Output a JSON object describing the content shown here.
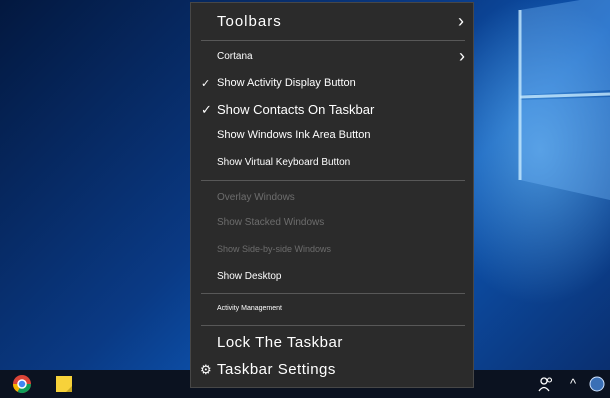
{
  "menu": {
    "toolbars": "Toolbars",
    "cortana": "Cortana",
    "show_activity": "Show Activity Display Button",
    "show_contacts": "Show Contacts On Taskbar",
    "show_ink": "Show Windows Ink Area Button",
    "show_keyboard": "Show Virtual Keyboard Button",
    "overlay": "Overlay Windows",
    "stacked": "Show Stacked Windows",
    "side_by_side": "Show Side-by-side Windows",
    "show_desktop": "Show Desktop",
    "activity_management": "Activity Management",
    "lock": "Lock The Taskbar",
    "settings": "Taskbar Settings",
    "checked": [
      "show_activity",
      "show_contacts"
    ],
    "disabled": [
      "overlay",
      "stacked",
      "side_by_side"
    ]
  },
  "icons": {
    "chevron": "›",
    "check": "✓",
    "gear": "⚙"
  },
  "colors": {
    "menu_bg": "#2b2b2b",
    "disabled_text": "#6d6d6d",
    "desktop_blue": "#0d57b5"
  }
}
